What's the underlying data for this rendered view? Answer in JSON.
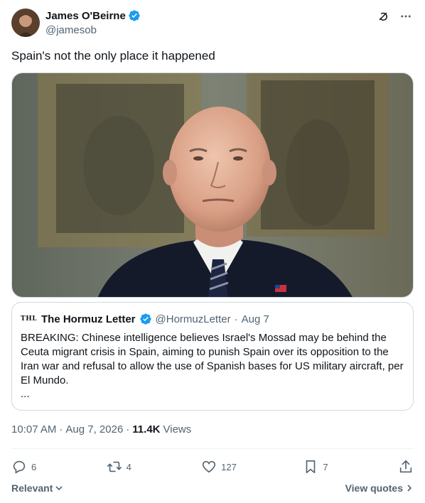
{
  "author": {
    "display_name": "James O'Beirne",
    "handle": "@jamesob",
    "verified": true
  },
  "tweet": {
    "text": "Spain's not the only place it happened",
    "media_description_icon": "photo"
  },
  "quote": {
    "logo_text": "THL",
    "display_name": "The Hormuz Letter",
    "handle": "@HormuzLetter",
    "separator": "·",
    "date": "Aug 7",
    "body": "BREAKING: Chinese intelligence believes Israel's Mossad may be behind the Ceuta migrant crisis in Spain, aiming to punish Spain over its opposition to the Iran war and refusal to allow the use of Spanish bases for US military aircraft, per El Mundo.",
    "ellipsis": "..."
  },
  "meta": {
    "time": "10:07 AM",
    "separator": "·",
    "date": "Aug 7, 2026",
    "separator2": "·",
    "views_count": "11.4K",
    "views_label": "Views"
  },
  "actions": {
    "replies": "6",
    "reposts": "4",
    "likes": "127",
    "bookmarks": "7"
  },
  "footer": {
    "relevant_label": "Relevant",
    "view_quotes_label": "View quotes"
  },
  "colors": {
    "text_primary": "#0f1419",
    "text_secondary": "#536471",
    "verified_blue": "#1d9bf0",
    "border": "#cfd9de"
  }
}
